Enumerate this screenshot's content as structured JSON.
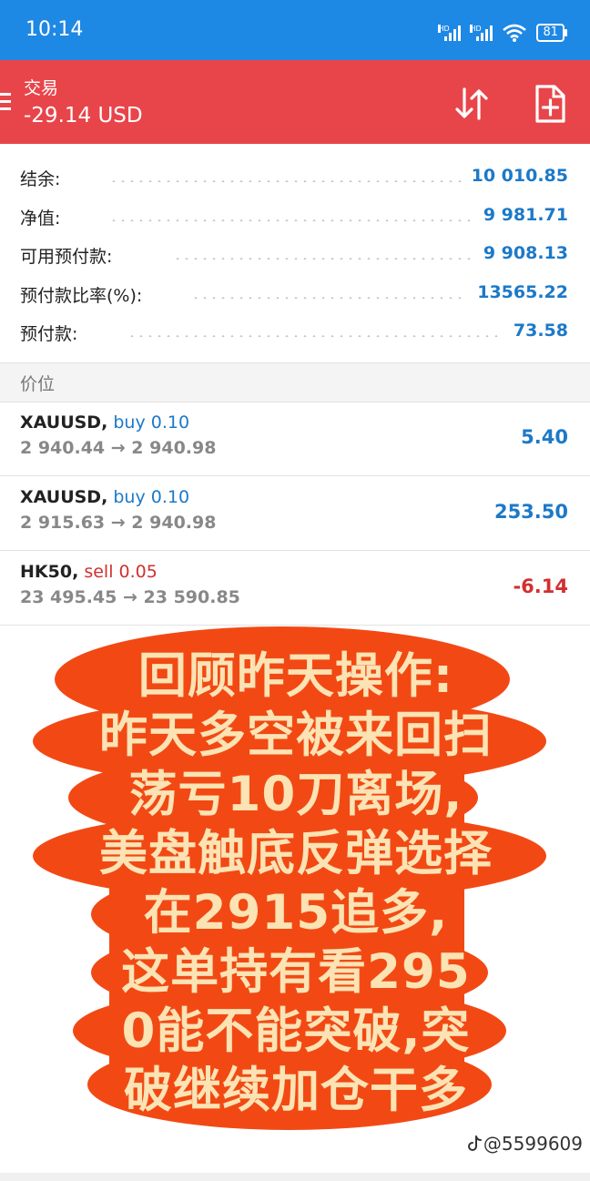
{
  "status_bar": {
    "time": "10:14",
    "battery": "81"
  },
  "header": {
    "title": "交易",
    "subtitle": "-29.14 USD"
  },
  "colors": {
    "header_bg": "#e8454a",
    "status_bg": "#1e88e5",
    "value_blue": "#1c79c8",
    "sell_red": "#d32f2f",
    "bubble": "#f24914"
  },
  "summary": [
    {
      "label": "结余:",
      "value": "10 010.85"
    },
    {
      "label": "净值:",
      "value": "9 981.71"
    },
    {
      "label": "可用预付款:",
      "value": "9 908.13"
    },
    {
      "label": "预付款比率(%):",
      "value": "13565.22"
    },
    {
      "label": "预付款:",
      "value": "73.58"
    }
  ],
  "section_title": "价位",
  "positions": [
    {
      "symbol": "XAUUSD,",
      "side": "buy 0.10",
      "prices": "2 940.44 → 2 940.98",
      "profit": "5.40"
    },
    {
      "symbol": "XAUUSD,",
      "side": "buy 0.10",
      "prices": "2 915.63 → 2 940.98",
      "profit": "253.50"
    },
    {
      "symbol": "HK50,",
      "side": "sell 0.05",
      "prices": "23 495.45 → 23 590.85",
      "profit": "-6.14"
    }
  ],
  "overlay_lines": [
    "回顾昨天操作:",
    "昨天多空被来回扫",
    "荡亏10刀离场,",
    "美盘触底反弹选择",
    "在2915追多,",
    "这单持有看295",
    "0能不能突破,突",
    "破继续加仓干多"
  ],
  "watermark": "@5599609"
}
